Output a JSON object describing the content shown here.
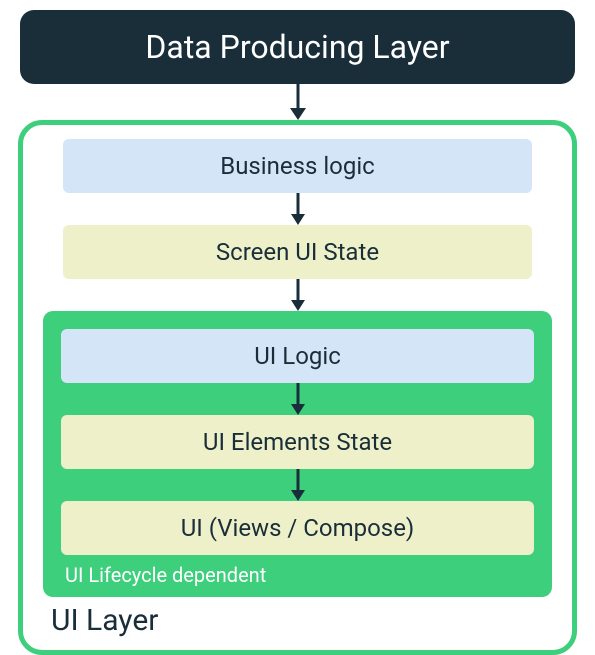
{
  "diagram": {
    "top_layer": "Data Producing Layer",
    "ui_layer": {
      "label": "UI Layer",
      "business_logic": "Business logic",
      "screen_ui_state": "Screen UI State",
      "lifecycle_section": {
        "label": "UI Lifecycle dependent",
        "ui_logic": "UI Logic",
        "ui_elements_state": "UI Elements State",
        "ui_views": "UI (Views / Compose)"
      }
    }
  }
}
